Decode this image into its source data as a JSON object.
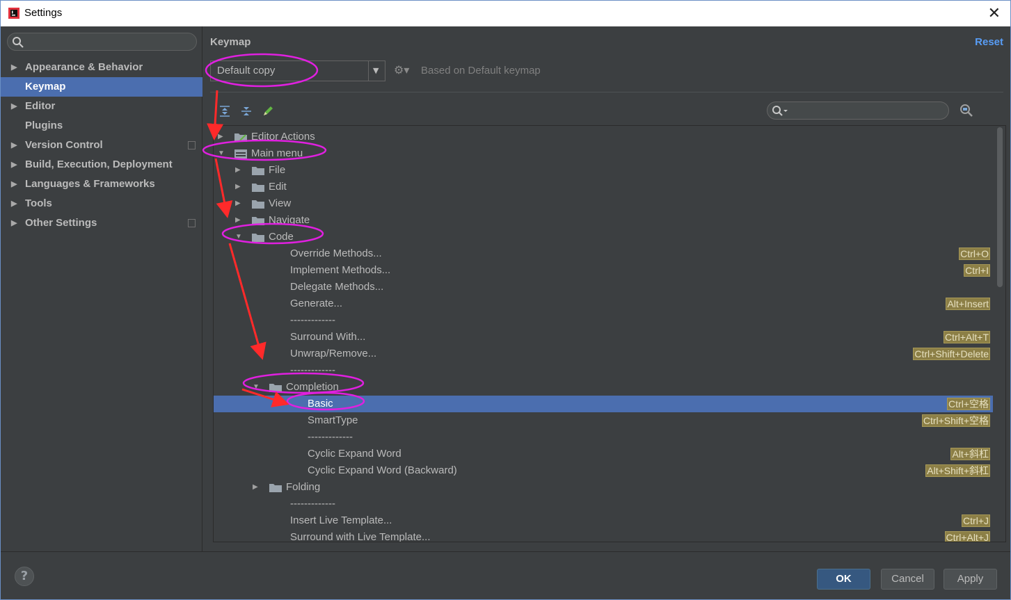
{
  "window": {
    "title": "Settings",
    "close_glyph": "✕"
  },
  "sidebar": {
    "search_placeholder": "",
    "items": [
      {
        "label": "Appearance & Behavior",
        "expandable": true,
        "project": false
      },
      {
        "label": "Keymap",
        "expandable": false,
        "selected": true,
        "project": false
      },
      {
        "label": "Editor",
        "expandable": true,
        "project": false
      },
      {
        "label": "Plugins",
        "expandable": false,
        "project": false
      },
      {
        "label": "Version Control",
        "expandable": true,
        "project": true
      },
      {
        "label": "Build, Execution, Deployment",
        "expandable": true,
        "project": false
      },
      {
        "label": "Languages & Frameworks",
        "expandable": true,
        "project": false
      },
      {
        "label": "Tools",
        "expandable": true,
        "project": false
      },
      {
        "label": "Other Settings",
        "expandable": true,
        "project": true
      }
    ]
  },
  "keymap": {
    "heading": "Keymap",
    "reset_label": "Reset",
    "combo_value": "Default copy",
    "based_on": "Based on Default keymap",
    "search_placeholder": ""
  },
  "tree": [
    {
      "text": "Editor Actions",
      "level": 0,
      "toggle": "collapsed",
      "icon": "actions"
    },
    {
      "text": "Main menu",
      "level": 0,
      "toggle": "expanded",
      "icon": "menu"
    },
    {
      "text": "File",
      "level": 1,
      "toggle": "collapsed",
      "icon": "folder"
    },
    {
      "text": "Edit",
      "level": 1,
      "toggle": "collapsed",
      "icon": "folder"
    },
    {
      "text": "View",
      "level": 1,
      "toggle": "collapsed",
      "icon": "folder"
    },
    {
      "text": "Navigate",
      "level": 1,
      "toggle": "collapsed",
      "icon": "folder"
    },
    {
      "text": "Code",
      "level": 1,
      "toggle": "expanded",
      "icon": "folder"
    },
    {
      "text": "Override Methods...",
      "level": 2,
      "shortcut": "Ctrl+O"
    },
    {
      "text": "Implement Methods...",
      "level": 2,
      "shortcut": "Ctrl+I"
    },
    {
      "text": "Delegate Methods...",
      "level": 2
    },
    {
      "text": "Generate...",
      "level": 2,
      "shortcut": "Alt+Insert"
    },
    {
      "text": "-------------",
      "level": 2
    },
    {
      "text": "Surround With...",
      "level": 2,
      "shortcut": "Ctrl+Alt+T"
    },
    {
      "text": "Unwrap/Remove...",
      "level": 2,
      "shortcut": "Ctrl+Shift+Delete"
    },
    {
      "text": "-------------",
      "level": 2
    },
    {
      "text": "Completion",
      "level": 2,
      "toggle": "expanded",
      "icon": "folder"
    },
    {
      "text": "Basic",
      "level": 3,
      "shortcut": "Ctrl+空格",
      "selected": true
    },
    {
      "text": "SmartType",
      "level": 3,
      "shortcut": "Ctrl+Shift+空格"
    },
    {
      "text": "-------------",
      "level": 3
    },
    {
      "text": "Cyclic Expand Word",
      "level": 3,
      "shortcut": "Alt+斜杠"
    },
    {
      "text": "Cyclic Expand Word (Backward)",
      "level": 3,
      "shortcut": "Alt+Shift+斜杠"
    },
    {
      "text": "Folding",
      "level": 2,
      "toggle": "collapsed",
      "icon": "folder"
    },
    {
      "text": "-------------",
      "level": 2
    },
    {
      "text": "Insert Live Template...",
      "level": 2,
      "shortcut": "Ctrl+J"
    },
    {
      "text": "Surround with Live Template...",
      "level": 2,
      "shortcut": "Ctrl+Alt+J"
    }
  ],
  "footer": {
    "help_label": "?",
    "ok_label": "OK",
    "cancel_label": "Cancel",
    "apply_label": "Apply"
  },
  "colors": {
    "background": "#3c3f41",
    "selection": "#4b6eaf",
    "link": "#589df6",
    "shortcut_bg": "#8c7f46",
    "annotation_ellipse": "#e020e0",
    "annotation_arrow": "#ff2a2a"
  }
}
